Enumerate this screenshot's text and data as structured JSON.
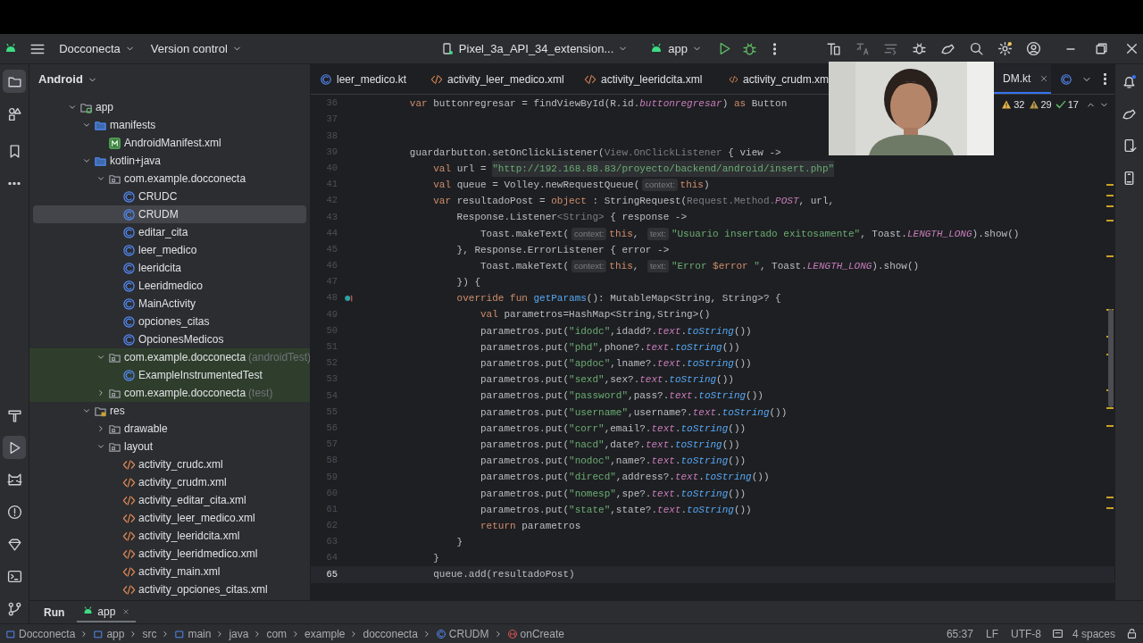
{
  "toolbar": {
    "project": "Docconecta",
    "vcs": "Version control",
    "device": "Pixel_3a_API_34_extension...",
    "run_config": "app"
  },
  "project_panel": {
    "view": "Android",
    "tree": [
      {
        "label": "app",
        "kind": "module",
        "expanded": true,
        "selected": false,
        "highlighted": false,
        "children": [
          {
            "label": "manifests",
            "kind": "folder",
            "expanded": true,
            "selected": false,
            "highlighted": false,
            "children": [
              {
                "label": "AndroidManifest.xml",
                "kind": "manifest",
                "selected": false,
                "highlighted": false
              }
            ]
          },
          {
            "label": "kotlin+java",
            "kind": "folder",
            "expanded": true,
            "selected": false,
            "highlighted": false,
            "children": [
              {
                "label": "com.example.docconecta",
                "kind": "package",
                "expanded": true,
                "selected": false,
                "highlighted": false,
                "children": [
                  {
                    "label": "CRUDC",
                    "kind": "class",
                    "selected": false,
                    "highlighted": false
                  },
                  {
                    "label": "CRUDM",
                    "kind": "class",
                    "selected": true,
                    "highlighted": false
                  },
                  {
                    "label": "editar_cita",
                    "kind": "class",
                    "selected": false,
                    "highlighted": false
                  },
                  {
                    "label": "leer_medico",
                    "kind": "class",
                    "selected": false,
                    "highlighted": false
                  },
                  {
                    "label": "leeridcita",
                    "kind": "class",
                    "selected": false,
                    "highlighted": false
                  },
                  {
                    "label": "Leeridmedico",
                    "kind": "class",
                    "selected": false,
                    "highlighted": false
                  },
                  {
                    "label": "MainActivity",
                    "kind": "class",
                    "selected": false,
                    "highlighted": false
                  },
                  {
                    "label": "opciones_citas",
                    "kind": "class",
                    "selected": false,
                    "highlighted": false
                  },
                  {
                    "label": "OpcionesMedicos",
                    "kind": "class",
                    "selected": false,
                    "highlighted": false
                  }
                ]
              },
              {
                "label": "com.example.docconecta",
                "suffix": "(androidTest)",
                "kind": "package",
                "expanded": true,
                "selected": false,
                "highlighted": true,
                "children": [
                  {
                    "label": "ExampleInstrumentedTest",
                    "kind": "class",
                    "selected": false,
                    "highlighted": true
                  }
                ]
              },
              {
                "label": "com.example.docconecta",
                "suffix": "(test)",
                "kind": "package",
                "expanded": false,
                "selected": false,
                "highlighted": true
              }
            ]
          },
          {
            "label": "res",
            "kind": "res",
            "expanded": true,
            "selected": false,
            "highlighted": false,
            "children": [
              {
                "label": "drawable",
                "kind": "package",
                "expanded": false,
                "selected": false,
                "highlighted": false
              },
              {
                "label": "layout",
                "kind": "package",
                "expanded": true,
                "selected": false,
                "highlighted": false,
                "children": [
                  {
                    "label": "activity_crudc.xml",
                    "kind": "xml",
                    "selected": false,
                    "highlighted": false
                  },
                  {
                    "label": "activity_crudm.xml",
                    "kind": "xml",
                    "selected": false,
                    "highlighted": false
                  },
                  {
                    "label": "activity_editar_cita.xml",
                    "kind": "xml",
                    "selected": false,
                    "highlighted": false
                  },
                  {
                    "label": "activity_leer_medico.xml",
                    "kind": "xml",
                    "selected": false,
                    "highlighted": false
                  },
                  {
                    "label": "activity_leeridcita.xml",
                    "kind": "xml",
                    "selected": false,
                    "highlighted": false
                  },
                  {
                    "label": "activity_leeridmedico.xml",
                    "kind": "xml",
                    "selected": false,
                    "highlighted": false
                  },
                  {
                    "label": "activity_main.xml",
                    "kind": "xml",
                    "selected": false,
                    "highlighted": false
                  },
                  {
                    "label": "activity_opciones_citas.xml",
                    "kind": "xml",
                    "selected": false,
                    "highlighted": false
                  }
                ]
              }
            ]
          }
        ]
      }
    ]
  },
  "editor_tabs": [
    {
      "label": "leer_medico.kt",
      "kind": "kotlin",
      "selected": false
    },
    {
      "label": "activity_leer_medico.xml",
      "kind": "xml",
      "selected": false
    },
    {
      "label": "activity_leeridcita.xml",
      "kind": "xml",
      "selected": false
    },
    {
      "label": "activity_crudm.xm",
      "kind": "xml",
      "selected": false
    },
    {
      "label": "DM.kt",
      "kind": "plain",
      "selected": true
    },
    {
      "kind": "kotlin",
      "selected": false
    }
  ],
  "inspections": [
    {
      "kind": "warning",
      "count": "32"
    },
    {
      "kind": "weak-warning",
      "count": "29"
    },
    {
      "kind": "typo",
      "count": "17"
    }
  ],
  "code": [
    {
      "number": "36",
      "current": false,
      "overrides": false,
      "tokens": [
        {
          "text": "        var",
          "kind": "kw"
        },
        {
          "text": " buttonregresar = findViewById(R.id.",
          "kind": "plain"
        },
        {
          "text": "buttonregresar",
          "kind": "prop"
        },
        {
          "text": ") ",
          "kind": "plain"
        },
        {
          "text": "as",
          "kind": "kw"
        },
        {
          "text": " Button",
          "kind": "plain"
        }
      ]
    },
    {
      "number": "37",
      "current": false,
      "overrides": false
    },
    {
      "number": "38",
      "current": false,
      "overrides": false
    },
    {
      "number": "39",
      "current": false,
      "overrides": false,
      "tokens": [
        {
          "text": "        guardarbutton.setOnClickListener(",
          "kind": "plain"
        },
        {
          "text": "View.OnClickListener",
          "kind": "dim"
        },
        {
          "text": " { view ->",
          "kind": "plain"
        }
      ]
    },
    {
      "number": "40",
      "current": false,
      "overrides": false,
      "tokens": [
        {
          "text": "            val",
          "kind": "kw"
        },
        {
          "text": " url = ",
          "kind": "plain"
        },
        {
          "text": "\"http://192.168.88.83/proyecto/backend/android/insert.php\"",
          "kind": "str-hl"
        }
      ]
    },
    {
      "number": "41",
      "current": false,
      "overrides": false,
      "tokens": [
        {
          "text": "            val",
          "kind": "kw"
        },
        {
          "text": " queue = Volley.newRequestQueue(",
          "kind": "plain"
        },
        {
          "text": "context:",
          "kind": "hint"
        },
        {
          "text": "this",
          "kind": "kw"
        },
        {
          "text": ")",
          "kind": "plain"
        }
      ]
    },
    {
      "number": "42",
      "current": false,
      "overrides": false,
      "tokens": [
        {
          "text": "            var",
          "kind": "kw"
        },
        {
          "text": " resultadoPost = ",
          "kind": "plain"
        },
        {
          "text": "object",
          "kind": "kw"
        },
        {
          "text": " : StringRequest(",
          "kind": "plain"
        },
        {
          "text": "Request.Method.",
          "kind": "dim"
        },
        {
          "text": "POST",
          "kind": "prop"
        },
        {
          "text": ", url,",
          "kind": "plain"
        }
      ]
    },
    {
      "number": "43",
      "current": false,
      "overrides": false,
      "tokens": [
        {
          "text": "                Response.Listener",
          "kind": "plain"
        },
        {
          "text": "<String>",
          "kind": "dim"
        },
        {
          "text": " { response ->",
          "kind": "plain"
        }
      ]
    },
    {
      "number": "44",
      "current": false,
      "overrides": false,
      "tokens": [
        {
          "text": "                    Toast.makeText(",
          "kind": "plain"
        },
        {
          "text": "context:",
          "kind": "hint"
        },
        {
          "text": "this",
          "kind": "kw"
        },
        {
          "text": ", ",
          "kind": "plain"
        },
        {
          "text": "text:",
          "kind": "hint"
        },
        {
          "text": "\"Usuario insertado exitosamente\"",
          "kind": "str"
        },
        {
          "text": ", Toast.",
          "kind": "plain"
        },
        {
          "text": "LENGTH_LONG",
          "kind": "prop"
        },
        {
          "text": ").show()",
          "kind": "plain"
        }
      ]
    },
    {
      "number": "45",
      "current": false,
      "overrides": false,
      "tokens": [
        {
          "text": "                }, Response.ErrorListener { error ->",
          "kind": "plain"
        }
      ]
    },
    {
      "number": "46",
      "current": false,
      "overrides": false,
      "tokens": [
        {
          "text": "                    Toast.makeText(",
          "kind": "plain"
        },
        {
          "text": "context:",
          "kind": "hint"
        },
        {
          "text": "this",
          "kind": "kw"
        },
        {
          "text": ", ",
          "kind": "plain"
        },
        {
          "text": "text:",
          "kind": "hint"
        },
        {
          "text": "\"Error ",
          "kind": "str"
        },
        {
          "text": "$error",
          "kind": "kw"
        },
        {
          "text": " \"",
          "kind": "str"
        },
        {
          "text": ", Toast.",
          "kind": "plain"
        },
        {
          "text": "LENGTH_LONG",
          "kind": "prop"
        },
        {
          "text": ").show()",
          "kind": "plain"
        }
      ]
    },
    {
      "number": "47",
      "current": false,
      "overrides": false,
      "tokens": [
        {
          "text": "                }) {",
          "kind": "plain"
        }
      ]
    },
    {
      "number": "48",
      "current": false,
      "overrides": true,
      "tokens": [
        {
          "text": "                override fun ",
          "kind": "kw"
        },
        {
          "text": "getParams",
          "kind": "fn"
        },
        {
          "text": "(): MutableMap<String, String>? {",
          "kind": "plain"
        }
      ]
    },
    {
      "number": "49",
      "current": false,
      "overrides": false,
      "tokens": [
        {
          "text": "                    val",
          "kind": "kw"
        },
        {
          "text": " parametros=HashMap<String,String>()",
          "kind": "plain"
        }
      ]
    },
    {
      "number": "50",
      "current": false,
      "overrides": false,
      "tokens": [
        {
          "text": "                    parametros.put(",
          "kind": "plain"
        },
        {
          "text": "\"idodc\"",
          "kind": "str"
        },
        {
          "text": ",idadd?.",
          "kind": "plain"
        },
        {
          "text": "text",
          "kind": "prop"
        },
        {
          "text": ".",
          "kind": "plain"
        },
        {
          "text": "toString",
          "kind": "ifn"
        },
        {
          "text": "())",
          "kind": "plain"
        }
      ]
    },
    {
      "number": "51",
      "current": false,
      "overrides": false,
      "tokens": [
        {
          "text": "                    parametros.put(",
          "kind": "plain"
        },
        {
          "text": "\"phd\"",
          "kind": "str"
        },
        {
          "text": ",phone?.",
          "kind": "plain"
        },
        {
          "text": "text",
          "kind": "prop"
        },
        {
          "text": ".",
          "kind": "plain"
        },
        {
          "text": "toString",
          "kind": "ifn"
        },
        {
          "text": "())",
          "kind": "plain"
        }
      ]
    },
    {
      "number": "52",
      "current": false,
      "overrides": false,
      "tokens": [
        {
          "text": "                    parametros.put(",
          "kind": "plain"
        },
        {
          "text": "\"apdoc\"",
          "kind": "str"
        },
        {
          "text": ",lname?.",
          "kind": "plain"
        },
        {
          "text": "text",
          "kind": "prop"
        },
        {
          "text": ".",
          "kind": "plain"
        },
        {
          "text": "toString",
          "kind": "ifn"
        },
        {
          "text": "())",
          "kind": "plain"
        }
      ]
    },
    {
      "number": "53",
      "current": false,
      "overrides": false,
      "tokens": [
        {
          "text": "                    parametros.put(",
          "kind": "plain"
        },
        {
          "text": "\"sexd\"",
          "kind": "str"
        },
        {
          "text": ",sex?.",
          "kind": "plain"
        },
        {
          "text": "text",
          "kind": "prop"
        },
        {
          "text": ".",
          "kind": "plain"
        },
        {
          "text": "toString",
          "kind": "ifn"
        },
        {
          "text": "())",
          "kind": "plain"
        }
      ]
    },
    {
      "number": "54",
      "current": false,
      "overrides": false,
      "tokens": [
        {
          "text": "                    parametros.put(",
          "kind": "plain"
        },
        {
          "text": "\"password\"",
          "kind": "str"
        },
        {
          "text": ",pass?.",
          "kind": "plain"
        },
        {
          "text": "text",
          "kind": "prop"
        },
        {
          "text": ".",
          "kind": "plain"
        },
        {
          "text": "toString",
          "kind": "ifn"
        },
        {
          "text": "())",
          "kind": "plain"
        }
      ]
    },
    {
      "number": "55",
      "current": false,
      "overrides": false,
      "tokens": [
        {
          "text": "                    parametros.put(",
          "kind": "plain"
        },
        {
          "text": "\"username\"",
          "kind": "str"
        },
        {
          "text": ",username?.",
          "kind": "plain"
        },
        {
          "text": "text",
          "kind": "prop"
        },
        {
          "text": ".",
          "kind": "plain"
        },
        {
          "text": "toString",
          "kind": "ifn"
        },
        {
          "text": "())",
          "kind": "plain"
        }
      ]
    },
    {
      "number": "56",
      "current": false,
      "overrides": false,
      "tokens": [
        {
          "text": "                    parametros.put(",
          "kind": "plain"
        },
        {
          "text": "\"corr\"",
          "kind": "str"
        },
        {
          "text": ",email?.",
          "kind": "plain"
        },
        {
          "text": "text",
          "kind": "prop"
        },
        {
          "text": ".",
          "kind": "plain"
        },
        {
          "text": "toString",
          "kind": "ifn"
        },
        {
          "text": "())",
          "kind": "plain"
        }
      ]
    },
    {
      "number": "57",
      "current": false,
      "overrides": false,
      "tokens": [
        {
          "text": "                    parametros.put(",
          "kind": "plain"
        },
        {
          "text": "\"nacd\"",
          "kind": "str"
        },
        {
          "text": ",date?.",
          "kind": "plain"
        },
        {
          "text": "text",
          "kind": "prop"
        },
        {
          "text": ".",
          "kind": "plain"
        },
        {
          "text": "toString",
          "kind": "ifn"
        },
        {
          "text": "())",
          "kind": "plain"
        }
      ]
    },
    {
      "number": "58",
      "current": false,
      "overrides": false,
      "tokens": [
        {
          "text": "                    parametros.put(",
          "kind": "plain"
        },
        {
          "text": "\"nodoc\"",
          "kind": "str"
        },
        {
          "text": ",name?.",
          "kind": "plain"
        },
        {
          "text": "text",
          "kind": "prop"
        },
        {
          "text": ".",
          "kind": "plain"
        },
        {
          "text": "toString",
          "kind": "ifn"
        },
        {
          "text": "())",
          "kind": "plain"
        }
      ]
    },
    {
      "number": "59",
      "current": false,
      "overrides": false,
      "tokens": [
        {
          "text": "                    parametros.put(",
          "kind": "plain"
        },
        {
          "text": "\"direcd\"",
          "kind": "str"
        },
        {
          "text": ",address?.",
          "kind": "plain"
        },
        {
          "text": "text",
          "kind": "prop"
        },
        {
          "text": ".",
          "kind": "plain"
        },
        {
          "text": "toString",
          "kind": "ifn"
        },
        {
          "text": "())",
          "kind": "plain"
        }
      ]
    },
    {
      "number": "60",
      "current": false,
      "overrides": false,
      "tokens": [
        {
          "text": "                    parametros.put(",
          "kind": "plain"
        },
        {
          "text": "\"nomesp\"",
          "kind": "str"
        },
        {
          "text": ",spe?.",
          "kind": "plain"
        },
        {
          "text": "text",
          "kind": "prop"
        },
        {
          "text": ".",
          "kind": "plain"
        },
        {
          "text": "toString",
          "kind": "ifn"
        },
        {
          "text": "())",
          "kind": "plain"
        }
      ]
    },
    {
      "number": "61",
      "current": false,
      "overrides": false,
      "tokens": [
        {
          "text": "                    parametros.put(",
          "kind": "plain"
        },
        {
          "text": "\"state\"",
          "kind": "str"
        },
        {
          "text": ",state?.",
          "kind": "plain"
        },
        {
          "text": "text",
          "kind": "prop"
        },
        {
          "text": ".",
          "kind": "plain"
        },
        {
          "text": "toString",
          "kind": "ifn"
        },
        {
          "text": "())",
          "kind": "plain"
        }
      ]
    },
    {
      "number": "62",
      "current": false,
      "overrides": false,
      "tokens": [
        {
          "text": "                    return",
          "kind": "kw"
        },
        {
          "text": " parametros",
          "kind": "plain"
        }
      ]
    },
    {
      "number": "63",
      "current": false,
      "overrides": false,
      "tokens": [
        {
          "text": "                }",
          "kind": "plain"
        }
      ]
    },
    {
      "number": "64",
      "current": false,
      "overrides": false,
      "tokens": [
        {
          "text": "            }",
          "kind": "plain"
        }
      ]
    },
    {
      "number": "65",
      "current": true,
      "overrides": false,
      "tokens": [
        {
          "text": "            queue.add(resultadoPost)",
          "kind": "plain"
        }
      ]
    }
  ],
  "bottom_tabs": [
    {
      "label": "Run",
      "kind": "plain",
      "selected": false
    },
    {
      "label": "app",
      "kind": "android",
      "selected": true
    }
  ],
  "status_bar": {
    "breadcrumbs": [
      {
        "label": "Docconecta",
        "kind": "module"
      },
      {
        "label": "app",
        "kind": "module"
      },
      {
        "label": "src",
        "kind": "plain"
      },
      {
        "label": "main",
        "kind": "module"
      },
      {
        "label": "java",
        "kind": "plain"
      },
      {
        "label": "com",
        "kind": "plain"
      },
      {
        "label": "example",
        "kind": "plain"
      },
      {
        "label": "docconecta",
        "kind": "plain"
      },
      {
        "label": "CRUDM",
        "kind": "class"
      },
      {
        "label": "onCreate",
        "kind": "method"
      }
    ],
    "position": "65:37",
    "line_separator": "LF",
    "encoding": "UTF-8",
    "indent": "4 spaces"
  }
}
